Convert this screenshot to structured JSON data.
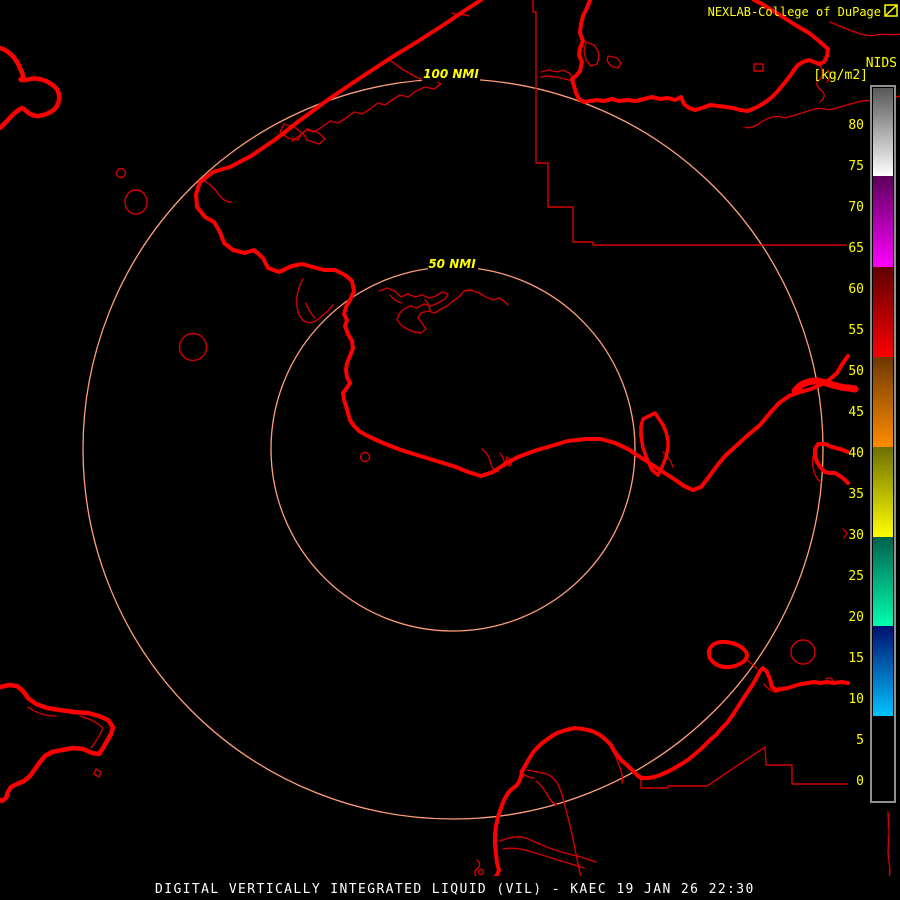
{
  "header": {
    "brand": "NEXLAB-College of DuPage",
    "logo_icon": "dupage-logo-icon"
  },
  "colorbar": {
    "title": "NIDS",
    "units": "[kg/m2]",
    "ticks": [
      "80",
      "75",
      "70",
      "65",
      "60",
      "55",
      "50",
      "45",
      "40",
      "35",
      "30",
      "25",
      "20",
      "15",
      "10",
      "5",
      "0"
    ],
    "segments": [
      {
        "values": "84-74",
        "top": "#585858",
        "bottom": "#FFFFFF"
      },
      {
        "values": "74-63",
        "top": "#5A005A",
        "bottom": "#FF00FF"
      },
      {
        "values": "63-52",
        "top": "#5E0000",
        "bottom": "#FB0000"
      },
      {
        "values": "52-41",
        "top": "#6E3800",
        "bottom": "#FF8C00"
      },
      {
        "values": "41-30",
        "top": "#6E6E00",
        "bottom": "#FFFF00"
      },
      {
        "values": "30-19",
        "top": "#00604E",
        "bottom": "#00FFB0"
      },
      {
        "values": "19-8",
        "top": "#000E6E",
        "bottom": "#00C4FF"
      },
      {
        "values": "8-0",
        "top": "#000000",
        "bottom": "#000000"
      }
    ]
  },
  "rings": {
    "outer": {
      "label": "100 NMI",
      "radius_nmi": 100
    },
    "inner": {
      "label": "50 NMI",
      "radius_nmi": 50
    }
  },
  "status_bar": {
    "text": "DIGITAL VERTICALLY INTEGRATED LIQUID (VIL) - KAEC 19 JAN 26 22:30",
    "product": "DIGITAL VERTICALLY INTEGRATED LIQUID (VIL)",
    "station": "KAEC",
    "datetime": "19 JAN 26 22:30"
  },
  "colors": {
    "background": "#000000",
    "coastline": "#FF0000",
    "boundary_thin": "#D40000",
    "range_ring": "#FFA07A",
    "label_yellow": "#FFFF00",
    "status_text": "#FFFFFF",
    "colorbar_border": "#909090"
  }
}
